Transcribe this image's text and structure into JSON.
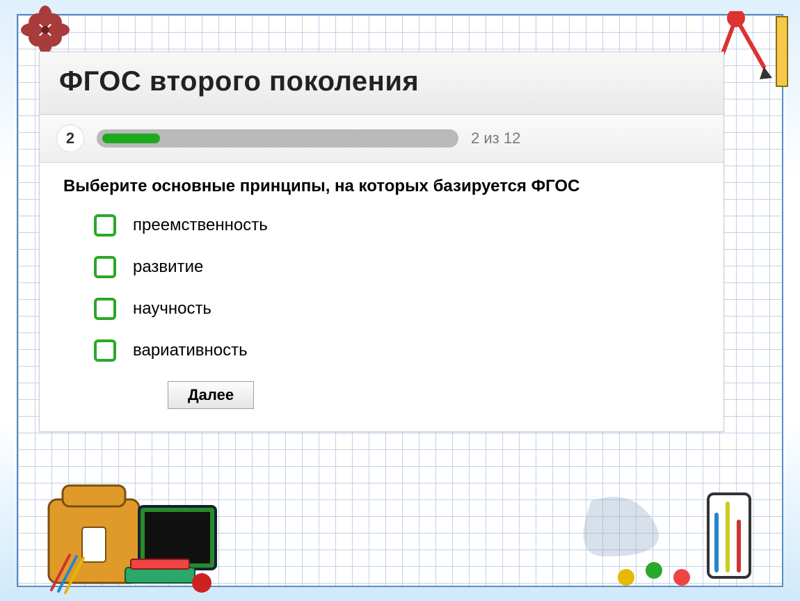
{
  "quiz": {
    "title": "ФГОС второго поколения",
    "current_step": "2",
    "progress_text": "2 из 12",
    "progress_percent": 16,
    "question": "Выберите основные принципы, на которых базируется ФГОС",
    "options": [
      {
        "label": "преемственность"
      },
      {
        "label": "развитие"
      },
      {
        "label": "научность"
      },
      {
        "label": "вариативность"
      }
    ],
    "next_label": "Далее"
  }
}
